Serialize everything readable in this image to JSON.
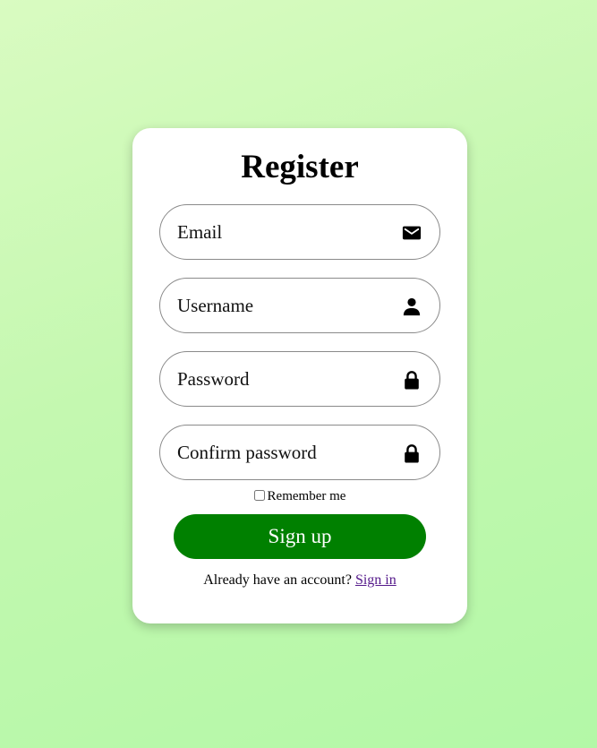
{
  "form": {
    "title": "Register",
    "fields": [
      {
        "placeholder": "Email",
        "value": "",
        "icon": "envelope-icon"
      },
      {
        "placeholder": "Username",
        "value": "",
        "icon": "user-icon"
      },
      {
        "placeholder": "Password",
        "value": "",
        "icon": "lock-icon"
      },
      {
        "placeholder": "Confirm password",
        "value": "",
        "icon": "lock-icon"
      }
    ],
    "remember_label": "Remember me",
    "remember_checked": false,
    "submit_label": "Sign up",
    "footer_text": "Already have an account?",
    "signin_link": "Sign in"
  },
  "colors": {
    "background_start": "#d9fbc1",
    "background_end": "#b3f8a7",
    "button": "#008000",
    "button_text": "#ffffff",
    "link_visited": "#551a8b"
  }
}
